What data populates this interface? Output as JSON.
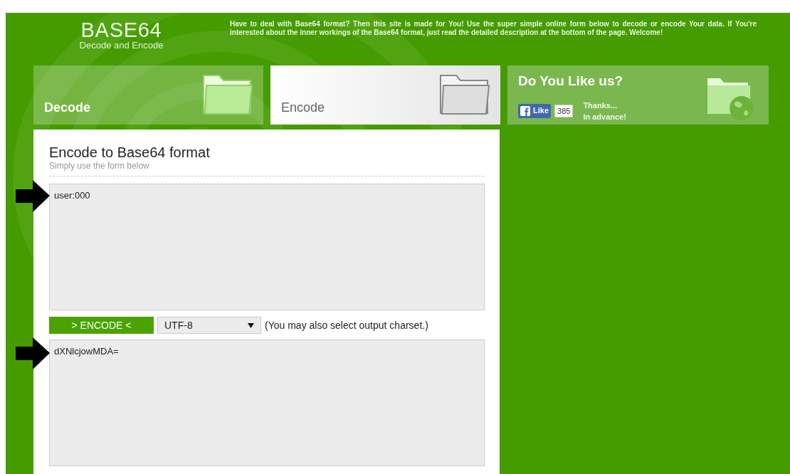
{
  "logo": {
    "title": "BASE64",
    "subtitle": "Decode and Encode"
  },
  "intro": "Have to deal with Base64 format? Then this site is made for You! Use the super simple online form below to decode or encode Your data. If You're interested about the inner workings of the Base64 format, just read the detailed description at the bottom of the page. Welcome!",
  "tabs": [
    {
      "label": "Decode",
      "selected": false
    },
    {
      "label": "Encode",
      "selected": true
    }
  ],
  "like_box": {
    "title": "Do You Like us?",
    "like_button": "Like",
    "count": "385",
    "thanks": "Thanks...",
    "advance": "In advance!"
  },
  "form": {
    "title": "Encode to Base64 format",
    "subtitle": "Simply use the form below",
    "input": "user:000",
    "button": "> ENCODE <",
    "charset": "UTF-8",
    "charset_note": "(You may also select output charset.)",
    "output": "dXNlcjowMDA="
  }
}
